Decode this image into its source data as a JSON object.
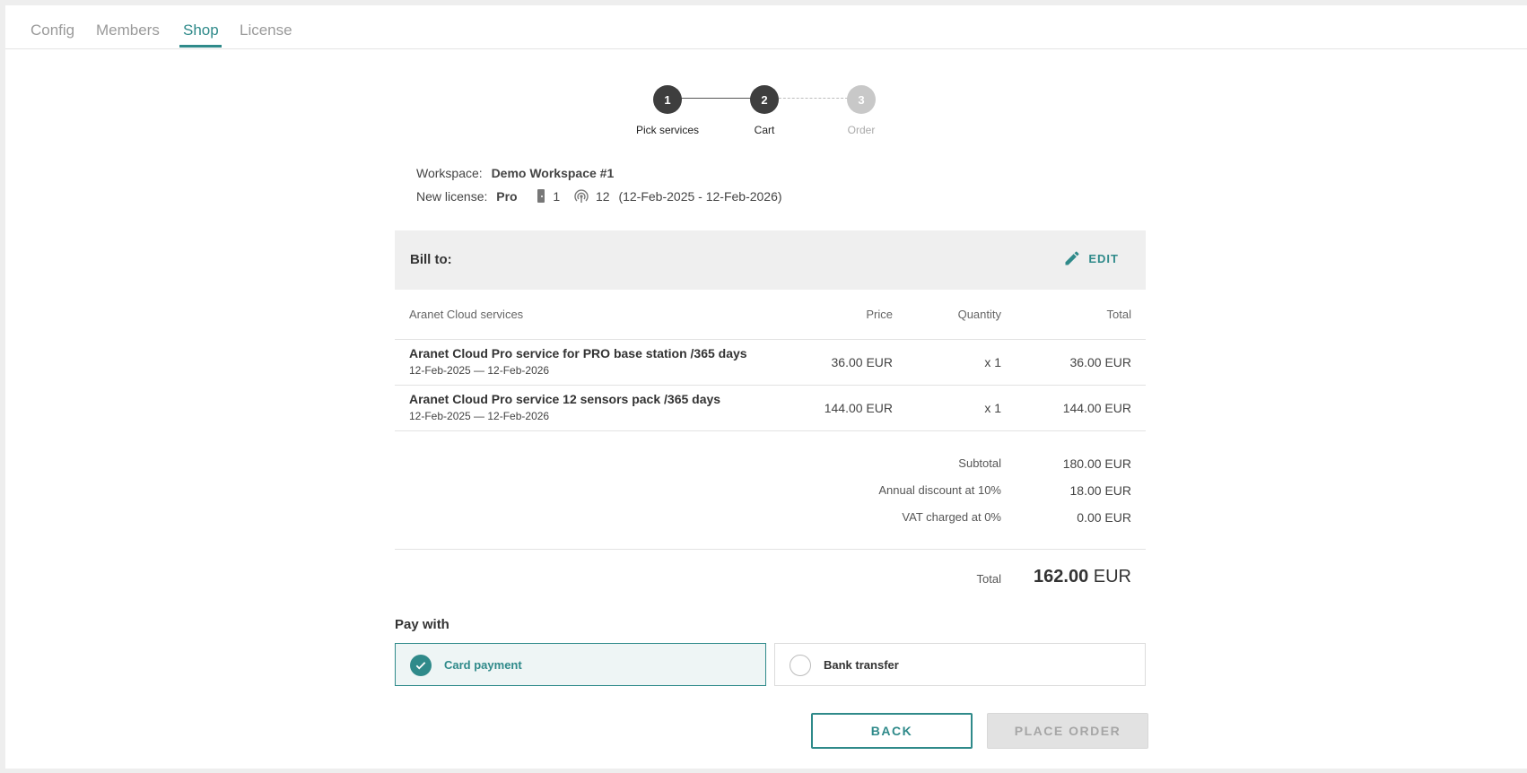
{
  "tabs": [
    {
      "label": "Config",
      "active": false
    },
    {
      "label": "Members",
      "active": false
    },
    {
      "label": "Shop",
      "active": true
    },
    {
      "label": "License",
      "active": false
    }
  ],
  "stepper": {
    "steps": [
      {
        "number": "1",
        "label": "Pick services",
        "state": "done"
      },
      {
        "number": "2",
        "label": "Cart",
        "state": "current"
      },
      {
        "number": "3",
        "label": "Order",
        "state": "pending"
      }
    ]
  },
  "info": {
    "workspace_label": "Workspace:",
    "workspace_value": "Demo Workspace #1",
    "license_label": "New license:",
    "license_value": "Pro",
    "base_stations": "1",
    "sensors": "12",
    "period": "(12-Feb-2025 - 12-Feb-2026)",
    "door_icon": "door-icon",
    "sensor_icon": "sensor-icon"
  },
  "bill_to": {
    "label": "Bill to:",
    "edit_label": "EDIT",
    "edit_icon": "pencil-icon"
  },
  "table": {
    "headers": {
      "service": "Aranet Cloud services",
      "price": "Price",
      "quantity": "Quantity",
      "total": "Total"
    },
    "rows": [
      {
        "name": "Aranet Cloud Pro service for PRO base station /365 days",
        "dates": "12-Feb-2025 — 12-Feb-2026",
        "price": "36.00 EUR",
        "quantity": "x 1",
        "total": "36.00 EUR"
      },
      {
        "name": "Aranet Cloud Pro service 12 sensors pack /365 days",
        "dates": "12-Feb-2025 — 12-Feb-2026",
        "price": "144.00 EUR",
        "quantity": "x 1",
        "total": "144.00 EUR"
      }
    ]
  },
  "summary": {
    "subtotal_label": "Subtotal",
    "subtotal_value": "180.00 EUR",
    "discount_label": "Annual discount at 10%",
    "discount_value": "18.00 EUR",
    "vat_label": "VAT charged at 0%",
    "vat_value": "0.00 EUR",
    "total_label": "Total",
    "total_amount": "162.00",
    "total_currency": "EUR"
  },
  "payment": {
    "title": "Pay with",
    "options": [
      {
        "label": "Card payment",
        "selected": true
      },
      {
        "label": "Bank transfer",
        "selected": false
      }
    ]
  },
  "actions": {
    "back_label": "BACK",
    "place_order_label": "PLACE ORDER"
  },
  "colors": {
    "accent": "#2f8a8a",
    "step_active": "#3e3e3e",
    "step_inactive": "#c8c8c8"
  }
}
